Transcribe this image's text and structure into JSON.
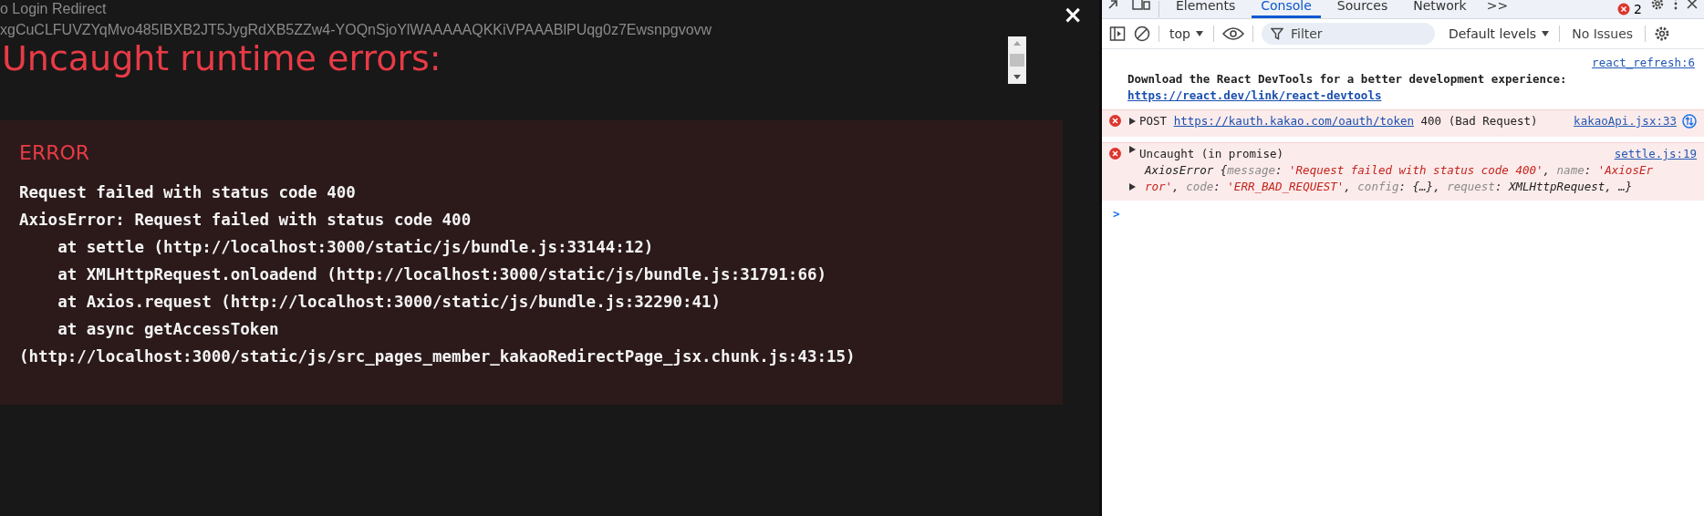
{
  "page": {
    "lines": [
      "o Login Redirect",
      "xgCuCLFUVZYqMvo485IBXB2JT5JygRdXB5ZZw4-YOQnSjoYlWAAAAAQKKiVPAAABlPUqg0z7Ewsnpgvovw"
    ]
  },
  "overlay": {
    "title": "Uncaught runtime errors:",
    "close": "×",
    "error": {
      "heading": "ERROR",
      "lines": [
        "Request failed with status code 400",
        "AxiosError: Request failed with status code 400",
        "    at settle (http://localhost:3000/static/js/bundle.js:33144:12)",
        "    at XMLHttpRequest.onloadend (http://localhost:3000/static/js/bundle.js:31791:66)",
        "    at Axios.request (http://localhost:3000/static/js/bundle.js:32290:41)",
        "    at async getAccessToken",
        "(http://localhost:3000/static/js/src_pages_member_kakaoRedirectPage_jsx.chunk.js:43:15)"
      ]
    }
  },
  "devtools": {
    "tabs": [
      {
        "label": "Elements",
        "selected": false
      },
      {
        "label": "Console",
        "selected": true
      },
      {
        "label": "Sources",
        "selected": false
      },
      {
        "label": "Network",
        "selected": false
      }
    ],
    "more": ">>",
    "error_count": "2",
    "toolbar": {
      "context": "top",
      "filter_placeholder": "Filter",
      "levels": "Default levels",
      "issues": "No Issues"
    },
    "console": [
      {
        "kind": "info",
        "source": "react_refresh:6",
        "text": "Download the React DevTools for a better development experience: ",
        "link": "https://react.dev/link/react-devtools"
      },
      {
        "kind": "network-error",
        "source": "kakaoApi.jsx:33",
        "method": "POST",
        "link": "https://kauth.kakao.com/oauth/token",
        "text": " 400 (Bad Request)"
      },
      {
        "kind": "exception",
        "source": "settle.js:19",
        "summary": "Uncaught (in promise)",
        "body": [
          {
            "kind": "plain",
            "text": "AxiosError {"
          },
          {
            "kind": "key",
            "text": "message"
          },
          {
            "kind": "plain",
            "text": ": "
          },
          {
            "kind": "string",
            "text": "'Request failed with status code 400'"
          },
          {
            "kind": "plain",
            "text": ", "
          },
          {
            "kind": "key",
            "text": "name"
          },
          {
            "kind": "plain",
            "text": ": "
          },
          {
            "kind": "string",
            "text": "'AxiosError'"
          },
          {
            "kind": "plain",
            "text": ", "
          },
          {
            "kind": "key",
            "text": "code"
          },
          {
            "kind": "plain",
            "text": ": "
          },
          {
            "kind": "string",
            "text": "'ERR_BAD_REQUEST'"
          },
          {
            "kind": "plain",
            "text": ", "
          },
          {
            "kind": "key",
            "text": "config"
          },
          {
            "kind": "plain",
            "text": ": {…}, "
          },
          {
            "kind": "key",
            "text": "request"
          },
          {
            "kind": "plain",
            "text": ": XMLHttpRequest, …}"
          }
        ]
      }
    ],
    "prompt": ">"
  }
}
